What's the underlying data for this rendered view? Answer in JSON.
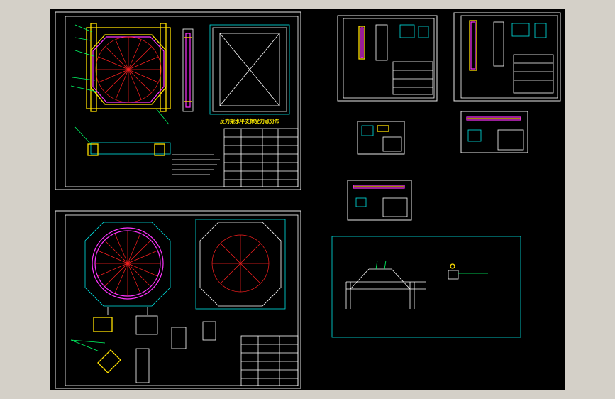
{
  "viewport": {
    "background": "#000000",
    "frame_color": "#d4d0c8"
  },
  "drawings": {
    "sheet1": {
      "title": "反力架水平支撑受力点分布",
      "views": [
        "octagon-frame-plan",
        "side-elevation",
        "square-frame-elevation",
        "bottom-section"
      ]
    },
    "sheet2": {
      "views": [
        "ring-octagon-plan",
        "octagon-flange-plan",
        "detail-nodes"
      ]
    },
    "thumbnails": [
      "detail-sheet-a",
      "detail-sheet-b",
      "detail-sheet-c",
      "detail-sheet-d",
      "detail-sheet-e"
    ],
    "bracket_sheet": {
      "views": [
        "bracket-frame-elevation",
        "bracket-small-detail"
      ]
    }
  },
  "colors": {
    "outline": "#00e5e5",
    "structure": "#ffe000",
    "centerline": "#ff2020",
    "ring": "#ff33ff",
    "annotation": "#00ff66",
    "sheet_border": "#ffffff"
  }
}
